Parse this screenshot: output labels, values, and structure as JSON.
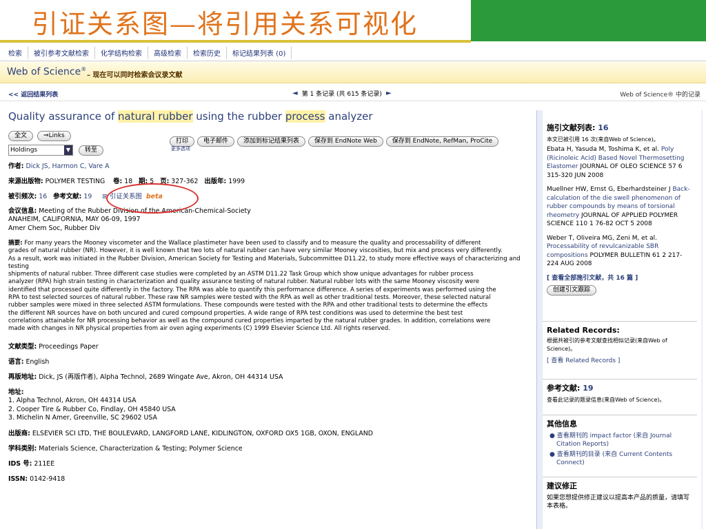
{
  "slide": {
    "title": "引证关系图—将引用关系可视化"
  },
  "nav": {
    "tabs": [
      "检索",
      "被引参考文献检索",
      "化学结构检索",
      "高级检索",
      "检索历史",
      "标记结果列表 (0)"
    ]
  },
  "wos": {
    "name": "Web of Science",
    "reg": "®",
    "subtitle": "– 现在可以同时检索会议录文献"
  },
  "result_nav": {
    "back": "<< 返回结果列表",
    "page": "第 1 条记录 (共 615 条记录)",
    "right": "Web of Science® 中的记录"
  },
  "record": {
    "title_parts": [
      "Quality assurance of ",
      "natural rubber",
      " using the rubber ",
      "process",
      " analyzer"
    ],
    "fulltext_btn": "全文",
    "links_btn": "Links",
    "holdings": "Holdings",
    "go_btn": "转至",
    "actions": [
      "打印",
      "电子邮件",
      "添加到标记结果列表",
      "保存到 EndNote Web",
      "保存到 EndNote, RefMan, ProCite"
    ],
    "more": "更多选项",
    "authors_label": "作者:",
    "authors": "Dick JS, Harmon C, Vare A",
    "source_label": "来源出版物:",
    "source": "POLYMER TESTING",
    "vol_label": "卷:",
    "vol": "18",
    "issue_label": "期:",
    "issue": "5",
    "pages_label": "页:",
    "pages": "327-362",
    "year_label": "出版年:",
    "year": "1999",
    "cited_label": "被引频次:",
    "cited": "16",
    "refs_label": "参考文献:",
    "refs": "19",
    "citemap": "引证关系图",
    "beta": "beta",
    "conf_label": "会议信息:",
    "conf1": "Meeting of the Rubber Division of the American-Chemical-Society",
    "conf2": "ANAHEIM, CALIFORNIA, MAY 06-09, 1997",
    "conf3": "Amer Chem Soc, Rubber Div",
    "abstract_label": "摘要:",
    "abstract_lines": [
      "For many years the Mooney viscometer and the Wallace plastimeter have been used to classify and to measure the quality and processability of different",
      "grades of natural rubber (NR). However, it is well known that two lots of natural rubber can have very similar Mooney viscosities, but mix and process very differently.",
      "As a result, work was initiated in the Rubber Division, American Society for Testing and Materials, Subcommittee D11.22, to study more effective ways of characterizing and testing",
      "shipments of natural rubber. Three different case studies were completed by an ASTM D11.22 Task Group which show unique advantages for rubber process",
      "analyzer (RPA) high strain testing in characterization and quality assurance testing of natural rubber. Natural rubber lots with the same Mooney viscosity were",
      "identified that processed quite differently in the factory. The RPA was able to quantify this performance difference. A series of experiments was performed using the",
      "RPA to test selected sources of natural rubber. These raw NR samples were tested with the RPA as well as other traditional tests. Moreover, these selected natural",
      "rubber samples were mixed in three selected ASTM formulations. These compounds were tested with the RPA and other traditional tests to determine the effects",
      "the different NR sources have on both uncured and cured compound properties. A wide range of RPA test conditions was used to determine the best test",
      "correlations attainable for NR processing behavior as well as the compound cured properties imparted by the natural rubber grades. In addition, correlations were",
      "made with changes in NR physical properties from air oven aging experiments (C) 1999 Elsevier Science Ltd. All rights reserved."
    ],
    "doctype_label": "文献类型:",
    "doctype": "Proceedings Paper",
    "lang_label": "语言:",
    "lang": "English",
    "reprint_label": "再版地址:",
    "reprint": "Dick, JS (再版作者), Alpha Technol, 2689 Wingate Ave, Akron, OH 44314 USA",
    "addr_label": "地址:",
    "addr": [
      "1. Alpha Technol, Akron, OH 44314 USA",
      "2. Cooper Tire & Rubber Co, Findlay, OH 45840 USA",
      "3. Michelin N Amer, Greenville, SC 29602 USA"
    ],
    "publisher_label": "出版商:",
    "publisher": "ELSEVIER SCI LTD, THE BOULEVARD, LANGFORD LANE, KIDLINGTON, OXFORD OX5 1GB, OXON, ENGLAND",
    "subject_label": "学科类别:",
    "subject": "Materials Science, Characterization & Testing; Polymer Science",
    "ids_label": "IDS 号:",
    "ids": "211EE",
    "issn_label": "ISSN:",
    "issn": "0142-9418"
  },
  "sidebar": {
    "citing_title": "施引文献列表:",
    "citing_count": "16",
    "citing_note": "本文已被引用 16 次(来自Web of Science)。",
    "citing": [
      {
        "authors": "Ebata H, Yasuda M, Toshima K, et al.",
        "title": "Poly (Ricinoleic Acid) Based Novel Thermosetting Elastomer",
        "source": "JOURNAL OF OLEO SCIENCE 57 6 315-320 JUN 2008"
      },
      {
        "authors": "Muellner HW, Ernst G, Eberhardsteiner J",
        "title": "Back-calculation of the die swell phenomenon of rubber compounds by means of torsional rheometry",
        "source": "JOURNAL OF APPLIED POLYMER SCIENCE 110 1 76-82 OCT 5 2008"
      },
      {
        "authors": "Weber T, Oliveira MG, Zeni M, et al.",
        "title": "Processability of revulcanizable SBR compositions",
        "source": "POLYMER BULLETIN 61 2 217-224 AUG 2008"
      }
    ],
    "see_all": "[ 查看全部施引文献，共 16 篇 ]",
    "create_alert": "创建引文跟踪",
    "related_title": "Related Records:",
    "related_note": "根据共被引的参考文献查找相似记录(来自Web of Science)。",
    "related_link": "[ 查看 Related Records ]",
    "refs_title": "参考文献:",
    "refs_count": "19",
    "refs_note": "查看此记录的题录信息(来自Web of Science)。",
    "other_title": "其他信息",
    "other": [
      "● 查看期刊的 impact factor (来自 Journal Citation Reports)",
      "● 查看期刊的目录 (来自 Current Contents Connect)"
    ],
    "suggest_title": "建议修正",
    "suggest_text": "如果您想提供修正建议以提高本产品的质量，请填写本表格。"
  }
}
